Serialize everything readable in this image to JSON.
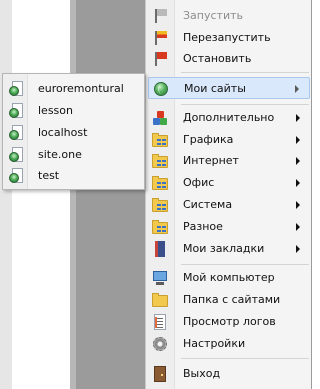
{
  "menu": {
    "items": [
      {
        "label": "Запустить",
        "icon": "flag-gray-icon",
        "disabled": true
      },
      {
        "label": "Перезапустить",
        "icon": "flag-yellow-red-icon"
      },
      {
        "label": "Остановить",
        "icon": "flag-red-icon"
      },
      {
        "label": "Мои сайты",
        "icon": "globe-icon",
        "submenu": true,
        "selected": true
      },
      {
        "label": "Дополнительно",
        "icon": "blocks-icon",
        "submenu": true
      },
      {
        "label": "Графика",
        "icon": "folder-grid-icon",
        "submenu": true
      },
      {
        "label": "Интернет",
        "icon": "folder-grid-icon",
        "submenu": true
      },
      {
        "label": "Офис",
        "icon": "folder-grid-icon",
        "submenu": true
      },
      {
        "label": "Система",
        "icon": "folder-grid-icon",
        "submenu": true
      },
      {
        "label": "Разное",
        "icon": "folder-grid-icon",
        "submenu": true
      },
      {
        "label": "Мои закладки",
        "icon": "bookmarks-book-icon",
        "submenu": true
      },
      {
        "label": "Мой компьютер",
        "icon": "computer-icon"
      },
      {
        "label": "Папка с сайтами",
        "icon": "folder-icon"
      },
      {
        "label": "Просмотр логов",
        "icon": "log-document-icon"
      },
      {
        "label": "Настройки",
        "icon": "gear-icon"
      },
      {
        "label": "Выход",
        "icon": "exit-door-icon"
      }
    ]
  },
  "submenu": {
    "items": [
      {
        "label": "euroremontural",
        "icon": "site-page-icon"
      },
      {
        "label": "lesson",
        "icon": "site-page-icon"
      },
      {
        "label": "localhost",
        "icon": "site-page-icon"
      },
      {
        "label": "site.one",
        "icon": "site-page-icon"
      },
      {
        "label": "test",
        "icon": "site-page-icon"
      }
    ]
  },
  "colors": {
    "menu_bg": "#f4f4f4",
    "highlight": "#d9e8fb",
    "highlight_border": "#a9c8ee",
    "disabled_text": "#8d8d8d",
    "background_gray": "#9b9b9b"
  }
}
